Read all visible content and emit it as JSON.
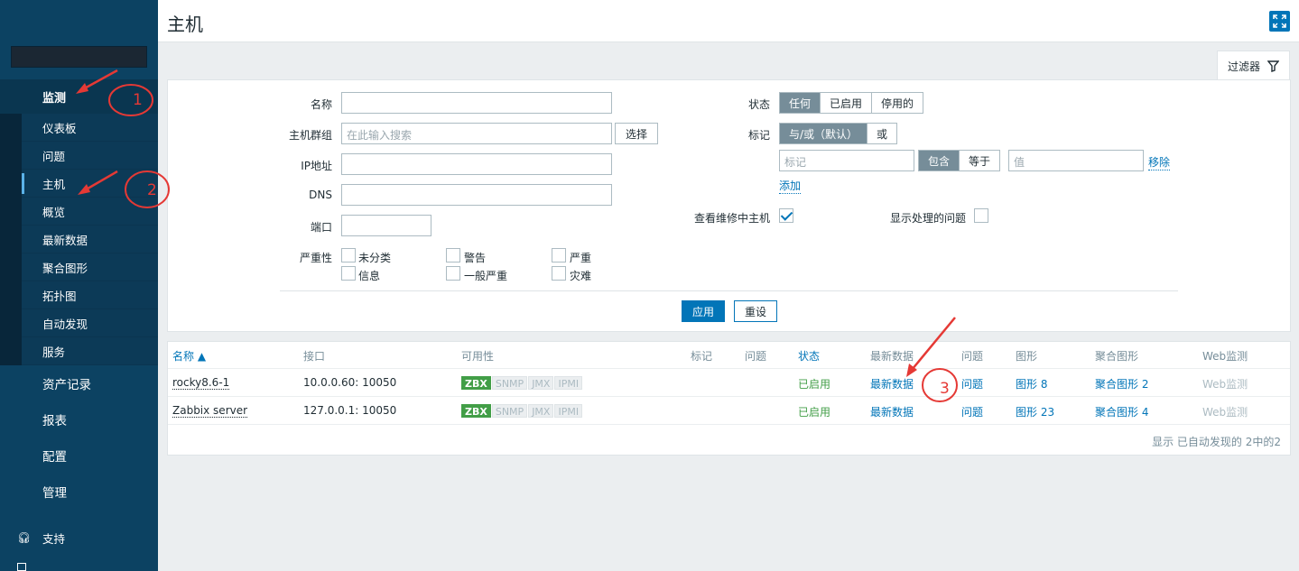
{
  "header": {
    "title": "主机"
  },
  "sidebar": {
    "monitoring": "监测",
    "sub_items": [
      {
        "label": "仪表板"
      },
      {
        "label": "问题"
      },
      {
        "label": "主机"
      },
      {
        "label": "概览"
      },
      {
        "label": "最新数据"
      },
      {
        "label": "聚合图形"
      },
      {
        "label": "拓扑图"
      },
      {
        "label": "自动发现"
      },
      {
        "label": "服务"
      }
    ],
    "main_items": [
      {
        "label": "资产记录"
      },
      {
        "label": "报表"
      },
      {
        "label": "配置"
      },
      {
        "label": "管理"
      }
    ],
    "support": "支持"
  },
  "filter": {
    "tab_label": "过滤器",
    "name_label": "名称",
    "hostgroup_label": "主机群组",
    "hostgroup_placeholder": "在此输入搜索",
    "select_btn": "选择",
    "ip_label": "IP地址",
    "dns_label": "DNS",
    "port_label": "端口",
    "severity_label": "严重性",
    "severities": [
      "未分类",
      "警告",
      "严重",
      "信息",
      "一般严重",
      "灾难"
    ],
    "status_label": "状态",
    "status_options": [
      "任何",
      "已启用",
      "停用的"
    ],
    "tags_label": "标记",
    "tags_logic": [
      "与/或（默认）",
      "或"
    ],
    "tag_placeholder": "标记",
    "tag_ops": [
      "包含",
      "等于"
    ],
    "value_placeholder": "值",
    "remove": "移除",
    "add": "添加",
    "maint_label": "查看维修中主机",
    "suppressed_label": "显示处理的问题",
    "apply": "应用",
    "reset": "重设"
  },
  "table": {
    "headers": {
      "name": "名称 ▲",
      "interface": "接口",
      "availability": "可用性",
      "tags": "标记",
      "problems": "问题",
      "status": "状态",
      "latest": "最新数据",
      "problems2": "问题",
      "graphs": "图形",
      "screens": "聚合图形",
      "web": "Web监测"
    },
    "rows": [
      {
        "name": "rocky8.6-1",
        "interface": "10.0.0.60: 10050",
        "status": "已启用",
        "latest": "最新数据",
        "problems": "问题",
        "graphs": "图形 8",
        "screens": "聚合图形 2",
        "web": "Web监测"
      },
      {
        "name": "Zabbix server",
        "interface": "127.0.0.1: 10050",
        "status": "已启用",
        "latest": "最新数据",
        "problems": "问题",
        "graphs": "图形 23",
        "screens": "聚合图形 4",
        "web": "Web监测"
      }
    ],
    "avail_tags": [
      "ZBX",
      "SNMP",
      "JMX",
      "IPMI"
    ],
    "footer": "显示 已自动发现的 2中的2"
  },
  "annotations": [
    "1",
    "2",
    "3"
  ],
  "colors": {
    "sidebar": "#0c4262",
    "accent": "#0275b8",
    "enabled": "#429e47",
    "annotation": "#e53935"
  }
}
